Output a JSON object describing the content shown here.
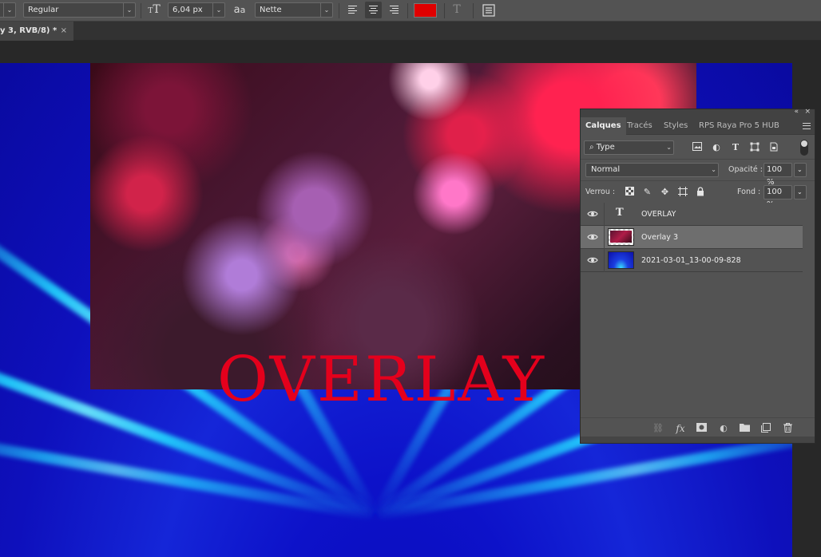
{
  "options_bar": {
    "font_style": "Regular",
    "font_size": "6,04 px",
    "antialias": "Nette",
    "text_color": "#e00000",
    "size_icon": "font-size-icon",
    "antialias_icon": "antialias-icon"
  },
  "document": {
    "tab_title": "y 3, RVB/8) *",
    "close_glyph": "×",
    "canvas_text": "OVERLAY",
    "canvas_text_color": "#e4001c"
  },
  "layers_panel": {
    "tabs": [
      "Calques",
      "Tracés",
      "Styles",
      "RPS Raya Pro 5 HUB"
    ],
    "active_tab": "Calques",
    "filter": "Type",
    "blend_mode": "Normal",
    "opacity_label": "Opacité :",
    "opacity_value": "100 %",
    "lock_label": "Verrou :",
    "fill_label": "Fond :",
    "fill_value": "100 %",
    "layers": [
      {
        "name": "OVERLAY",
        "kind": "text",
        "visible": true,
        "selected": false
      },
      {
        "name": "Overlay 3",
        "kind": "image",
        "visible": true,
        "selected": true
      },
      {
        "name": "2021-03-01_13-00-09-828",
        "kind": "image",
        "visible": true,
        "selected": false
      }
    ],
    "bottom_icons": [
      "link-layers-icon",
      "fx-icon",
      "add-mask-icon",
      "adjustment-layer-icon",
      "group-folder-icon",
      "new-layer-icon",
      "trash-icon"
    ],
    "fx_label": "fx"
  }
}
